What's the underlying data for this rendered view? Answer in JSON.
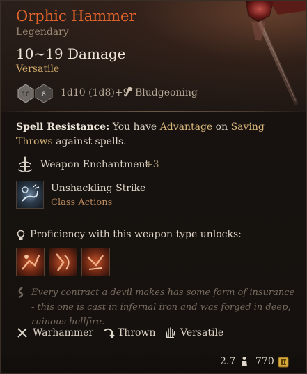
{
  "item": {
    "name": "Orphic Hammer",
    "rarity": "Legendary",
    "damage": "10~19 Damage",
    "property_line": "Versatile",
    "dice": [
      "10",
      "8"
    ],
    "dice_roll": "1d10 (1d8)+9",
    "damage_type": "Bludgeoning"
  },
  "passives": {
    "spell_resistance": {
      "title": "Spell Resistance:",
      "text_1": " You have ",
      "advantage": "Advantage",
      "text_2": " on ",
      "saving_throws": "Saving Throws",
      "text_3": " against spells."
    },
    "enchantment": {
      "label": "Weapon Enchantment",
      "value": "+3"
    }
  },
  "action": {
    "name": "Unshackling Strike",
    "category": "Class Actions"
  },
  "proficiency": {
    "label": "Proficiency with this weapon type unlocks:",
    "slots": [
      "weapon-action-1",
      "weapon-action-2",
      "weapon-action-3"
    ]
  },
  "lore": "Every contract a devil makes has some form of insurance - this one is cast in infernal iron and was forged in deep, ruinous hellfire.",
  "properties": [
    "Warhammer",
    "Thrown",
    "Versatile"
  ],
  "footer": {
    "weight": "2.7",
    "price": "770"
  },
  "colors": {
    "title": "#e0632c",
    "accent_gold": "#d9b77a",
    "class_action": "#b9895e",
    "lore": "#76695d"
  }
}
